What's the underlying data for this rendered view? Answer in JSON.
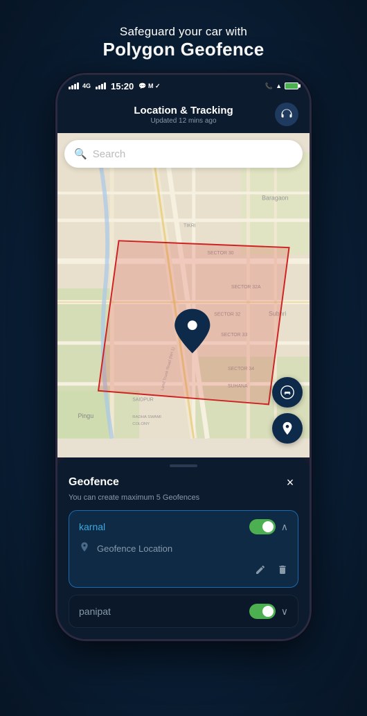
{
  "page": {
    "headline_sub": "Safeguard your car with",
    "headline_main": "Polygon Geofence"
  },
  "status_bar": {
    "time": "15:20",
    "signal": "4G",
    "icons_right": [
      "wifi",
      "battery"
    ]
  },
  "app_header": {
    "title": "Location & Tracking",
    "subtitle": "Updated 12 mins ago",
    "headphone_icon": "🎧"
  },
  "search": {
    "placeholder": "Search"
  },
  "map_buttons": [
    {
      "id": "car-location-btn",
      "icon": "car"
    },
    {
      "id": "pin-btn",
      "icon": "pin"
    }
  ],
  "geofence_panel": {
    "handle": true,
    "title": "Geofence",
    "close_label": "×",
    "subtitle": "You can create maximum 5 Geofences",
    "items": [
      {
        "id": "karnal",
        "name": "karnal",
        "toggle_on": true,
        "expanded": true,
        "location_label": "Geofence Location",
        "edit_icon": "✎",
        "delete_icon": "🗑"
      },
      {
        "id": "panipat",
        "name": "panipat",
        "toggle_on": true,
        "expanded": false
      }
    ]
  }
}
